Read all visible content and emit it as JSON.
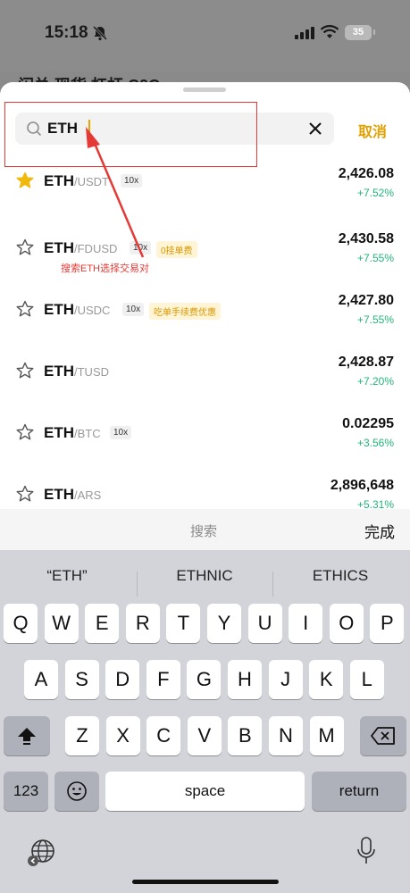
{
  "status_bar": {
    "time": "15:18",
    "battery": "35"
  },
  "backdrop_tabs": "闪兑   现货   杠杆   C2C",
  "search": {
    "value": "ETH",
    "cancel_label": "取消"
  },
  "annotation": {
    "text": "搜索ETH选择交易对",
    "color": "#e53935"
  },
  "pairs": [
    {
      "base": "ETH",
      "quote": "/USDT",
      "leverage": "10x",
      "promo": "",
      "price": "2,426.08",
      "change": "+7.52%",
      "favorite": true
    },
    {
      "base": "ETH",
      "quote": "/FDUSD",
      "leverage": "10x",
      "promo": "0挂单费",
      "price": "2,430.58",
      "change": "+7.55%",
      "favorite": false
    },
    {
      "base": "ETH",
      "quote": "/USDC",
      "leverage": "10x",
      "promo": "吃单手续费优惠",
      "price": "2,427.80",
      "change": "+7.55%",
      "favorite": false
    },
    {
      "base": "ETH",
      "quote": "/TUSD",
      "leverage": "",
      "promo": "",
      "price": "2,428.87",
      "change": "+7.20%",
      "favorite": false
    },
    {
      "base": "ETH",
      "quote": "/BTC",
      "leverage": "10x",
      "promo": "",
      "price": "0.02295",
      "change": "+3.56%",
      "favorite": false
    },
    {
      "base": "ETH",
      "quote": "/ARS",
      "leverage": "",
      "promo": "",
      "price": "2,896,648",
      "change": "+5.31%",
      "favorite": false
    }
  ],
  "keyboard_toolbar": {
    "search_label": "搜索",
    "done_label": "完成"
  },
  "suggestions": [
    "“ETH”",
    "ETHNIC",
    "ETHICS"
  ],
  "keys": {
    "row1": [
      "Q",
      "W",
      "E",
      "R",
      "T",
      "Y",
      "U",
      "I",
      "O",
      "P"
    ],
    "row2": [
      "A",
      "S",
      "D",
      "F",
      "G",
      "H",
      "J",
      "K",
      "L"
    ],
    "row3": [
      "Z",
      "X",
      "C",
      "V",
      "B",
      "N",
      "M"
    ],
    "numbers_label": "123",
    "space_label": "space",
    "return_label": "return"
  },
  "colors": {
    "accent": "#e0a100",
    "positive": "#22b57a",
    "annotation": "#e53935"
  }
}
